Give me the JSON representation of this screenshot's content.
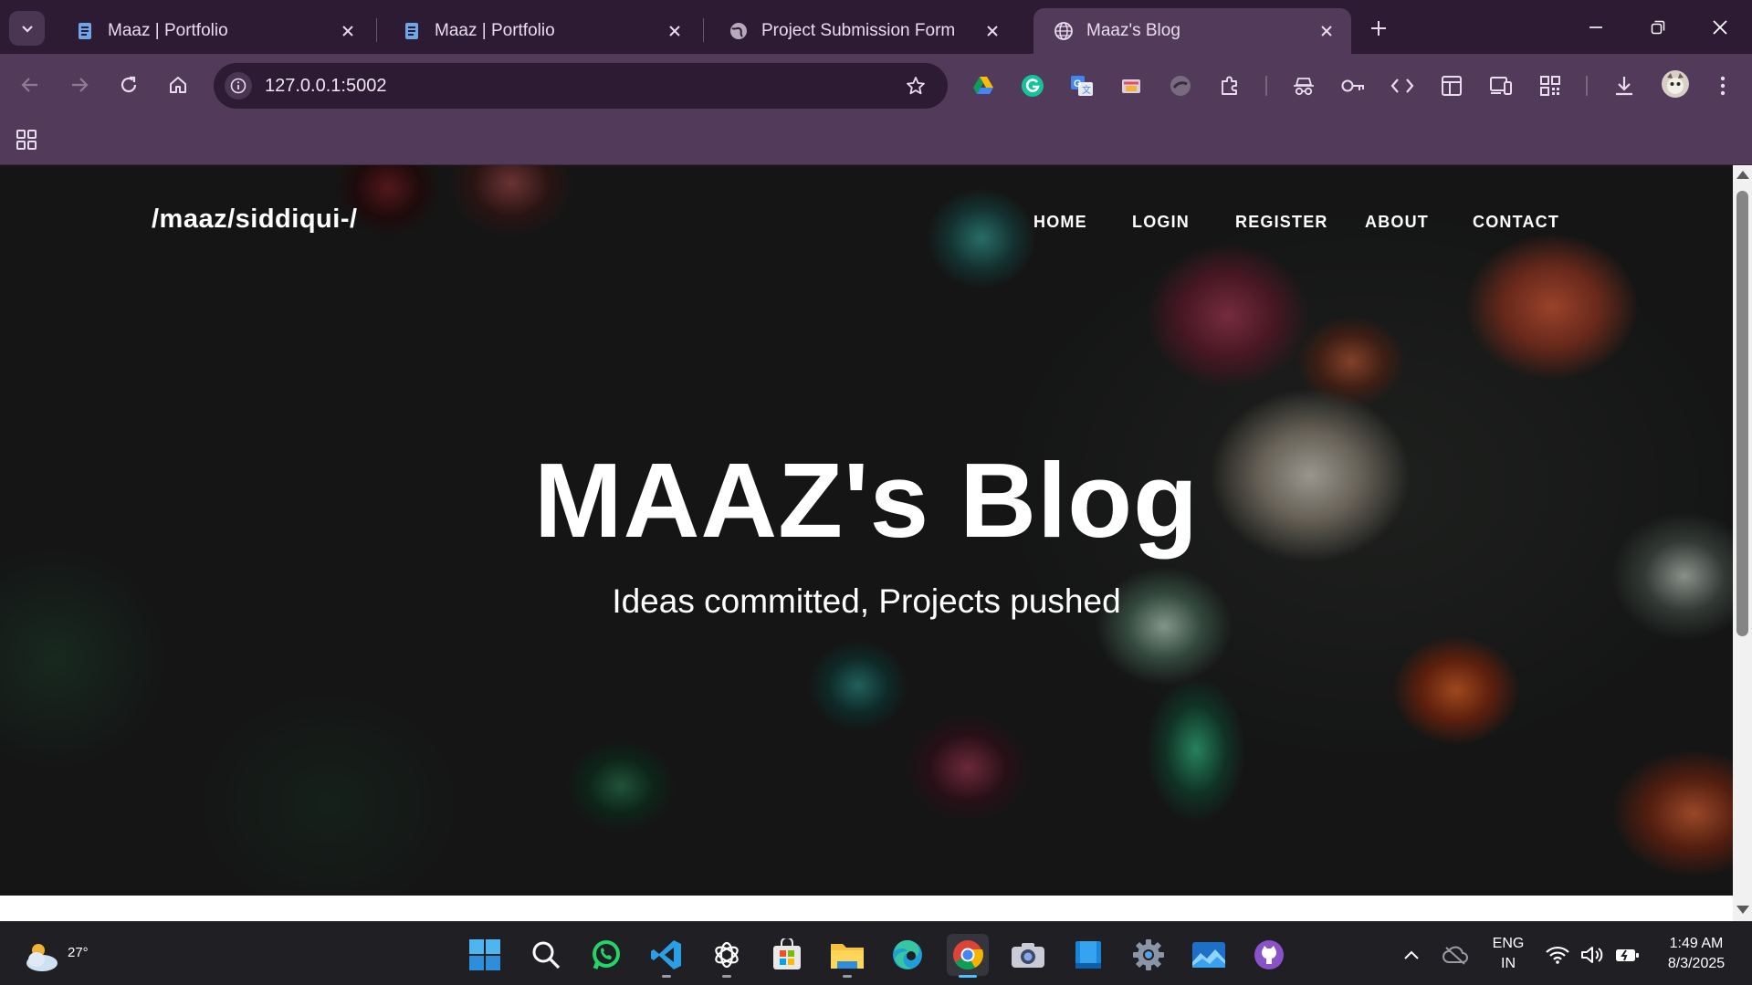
{
  "browser": {
    "tabs": [
      {
        "title": "Maaz | Portfolio",
        "favicon": "document-icon",
        "active": false
      },
      {
        "title": "Maaz | Portfolio",
        "favicon": "document-icon",
        "active": false
      },
      {
        "title": "Project Submission Form",
        "favicon": "globe-icon",
        "active": false
      },
      {
        "title": "Maaz's Blog",
        "favicon": "globe-icon",
        "active": true
      }
    ],
    "url": "127.0.0.1:5002",
    "extensions": [
      "google-drive-icon",
      "grammarly-icon",
      "google-translate-icon",
      "screenshot-icon",
      "blocked-icon",
      "extensions-puzzle-icon",
      "incognito-icon",
      "password-key-icon",
      "code-icon",
      "layout-icon",
      "devices-icon",
      "qr-code-icon",
      "download-icon",
      "profile-avatar"
    ]
  },
  "site": {
    "brand": "/maaz/siddiqui-/",
    "nav": [
      "HOME",
      "LOGIN",
      "REGISTER",
      "ABOUT",
      "CONTACT"
    ],
    "hero_title": "MAAZ's Blog",
    "hero_subtitle": "Ideas committed, Projects pushed"
  },
  "taskbar": {
    "weather_temp": "27°",
    "apps": [
      "windows-start-icon",
      "search-icon",
      "whatsapp-icon",
      "vscode-icon",
      "chatgpt-icon",
      "microsoft-store-icon",
      "file-explorer-icon",
      "edge-icon",
      "chrome-icon",
      "camera-icon",
      "notes-icon",
      "settings-icon",
      "photos-icon",
      "github-icon"
    ],
    "language_line1": "ENG",
    "language_line2": "IN",
    "time": "1:49 AM",
    "date": "8/3/2025"
  },
  "colors": {
    "titlebar": "#2d1a33",
    "toolbar": "#523a5b",
    "taskbar": "#1f1f24",
    "chrome_active_indicator": "#4cc2ff"
  }
}
